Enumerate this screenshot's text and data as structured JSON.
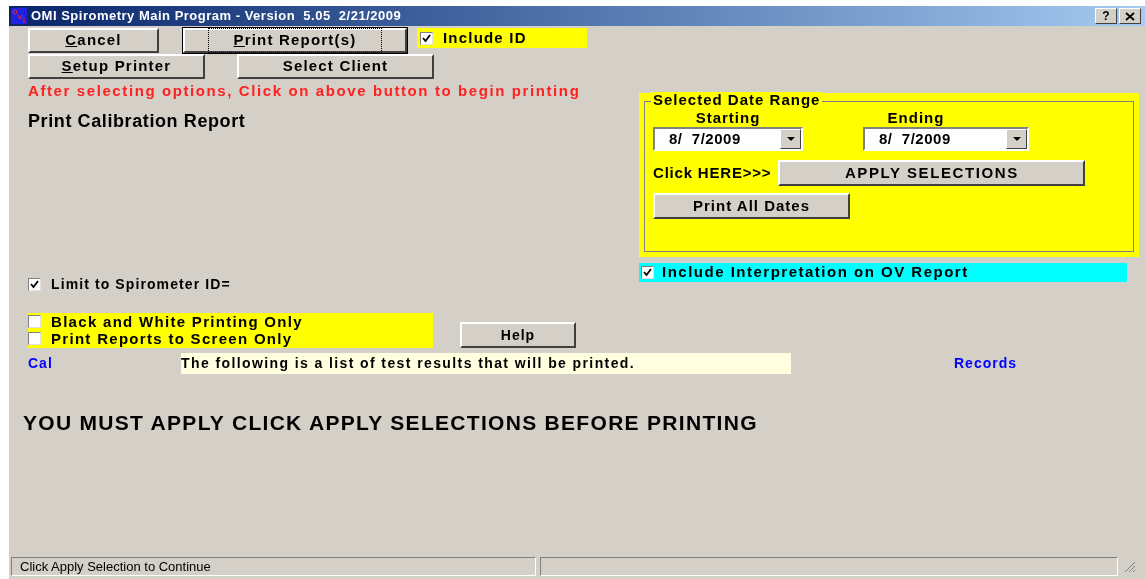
{
  "window": {
    "title": "OMI Spirometry Main Program - Version  5.05  2/21/2009",
    "help_button": "?"
  },
  "buttons_row_1": [
    {
      "label": "Cancel",
      "first_letter_underlined": true,
      "focused": false
    },
    {
      "label": "Print Report(s)",
      "first_letter_underlined": true,
      "focused": true
    }
  ],
  "include_id": {
    "label": "Include ID",
    "checked": true
  },
  "buttons_row_2": [
    {
      "label": "Setup Printer",
      "first_letter_underlined": true,
      "focused": false
    },
    {
      "label": "Select Client",
      "first_letter_underlined": false,
      "focused": false
    }
  ],
  "instruction": "After selecting options, Click on above button to begin printing",
  "report_title": "Print Calibration Report",
  "date_range": {
    "title": "Selected Date Range",
    "starting_label": "Starting",
    "starting_value": "8/  7/2009",
    "ending_label": "Ending",
    "ending_value": "8/  7/2009",
    "click_here": "Click HERE>>>",
    "apply_button": "APPLY SELECTIONS",
    "print_all_button": "Print All Dates"
  },
  "include_interpretation": {
    "label": "Include Interpretation on OV Report",
    "checked": true
  },
  "limit_spirometer": {
    "label": "Limit to Spirometer ID=",
    "checked": true
  },
  "print_options": [
    {
      "label": "Black and White Printing Only",
      "checked": false
    },
    {
      "label": "Print Reports to Screen Only",
      "checked": false
    }
  ],
  "help_button": "Help",
  "list_header": {
    "left": "Cal",
    "notice": "The following is a list of test results that will be printed.",
    "right": "Records"
  },
  "warning": "YOU MUST APPLY CLICK APPLY SELECTIONS BEFORE PRINTING",
  "status_bar": {
    "message": "Click Apply Selection to Continue"
  }
}
